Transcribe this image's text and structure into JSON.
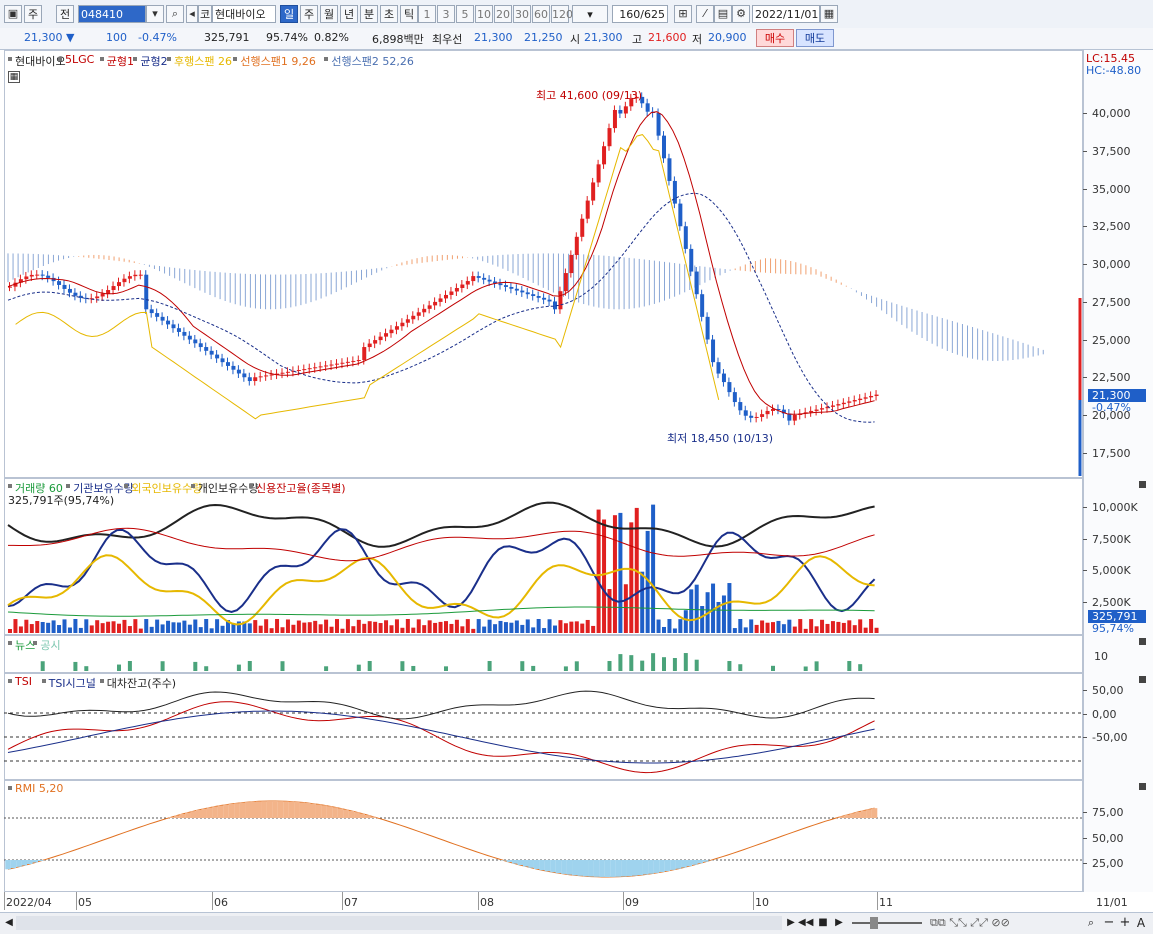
{
  "toolbar": {
    "market_label": "주",
    "prev_label": "전",
    "code_value": "048410",
    "code_type_label": "코",
    "stock_name": "현대바이오",
    "periods": [
      "일",
      "주",
      "월",
      "년",
      "분",
      "초",
      "틱"
    ],
    "minute_steps": [
      "1",
      "3",
      "5",
      "10",
      "20",
      "30",
      "60",
      "120"
    ],
    "count_value": "160",
    "count_total": "/625",
    "date_value": "2022/11/01"
  },
  "quote": {
    "price": "21,300",
    "change": "100",
    "change_pct": "-0.47%",
    "volume": "325,791",
    "vol_ratio": "95.74%",
    "turnover": "0.82%",
    "amount": "6,898백만",
    "best_bid_label": "최우선",
    "best_ask": "21,300",
    "best_bid": "21,250",
    "open_label": "시",
    "open": "21,300",
    "high_label": "고",
    "high": "21,600",
    "low_label": "저",
    "low": "20,900",
    "buy_label": "매수",
    "sell_label": "매도"
  },
  "price_panel": {
    "legend": [
      "현대바이오",
      "5LGC",
      "균형1",
      "균형2",
      "후행스팬 26",
      "선행스팬1 9,26",
      "선행스팬2 52,26"
    ],
    "legend_colors": [
      "#222222",
      "#c00000",
      "#c00000",
      "#1a2f8a",
      "#e6b800",
      "#e07020",
      "#4a6fb0"
    ],
    "lc": "LC:15.45",
    "hc": "HC:-48.80",
    "max_label": "최고 41,600 (09/13)",
    "min_label": "최저 18,450 (10/13)",
    "last_price_tag": "21,300",
    "last_pct_tag": "-0.47%",
    "y_ticks": [
      "40,000",
      "37,500",
      "35,000",
      "32,500",
      "30,000",
      "27,500",
      "25,000",
      "22,500",
      "20,000",
      "17,500"
    ]
  },
  "volume_panel": {
    "legend": [
      "거래량 60",
      "기관보유수량",
      "외국인보유수량",
      "개인보유수량",
      "신용잔고율(종목별)"
    ],
    "legend_colors": [
      "#1a9a3a",
      "#1a2f8a",
      "#e6b800",
      "#222222",
      "#c00000"
    ],
    "sub": "325,791주(95,74%)",
    "y_ticks": [
      "10,000K",
      "7,500K",
      "5,000K",
      "2,500K"
    ],
    "tag_value": "325,791",
    "tag_pct": "95,74%"
  },
  "news_panel": {
    "legend": [
      "뉴스",
      "공시"
    ],
    "y_tick": "10"
  },
  "tsi_panel": {
    "legend": [
      "TSI",
      "TSI시그널",
      "대차잔고(주수)"
    ],
    "legend_colors": [
      "#c00000",
      "#1a2f8a",
      "#222222"
    ],
    "y_ticks": [
      "50,00",
      "0,00",
      "-50,00"
    ]
  },
  "rmi_panel": {
    "legend": [
      "RMI 5,20"
    ],
    "y_ticks": [
      "75,00",
      "50,00",
      "25,00"
    ]
  },
  "x_axis": [
    "2022/04",
    "05",
    "06",
    "07",
    "08",
    "09",
    "10",
    "11"
  ],
  "x_axis_right": "11/01",
  "colors": {
    "up": "#e02020",
    "down": "#1f5fc8",
    "accent": "#2e68c8"
  }
}
